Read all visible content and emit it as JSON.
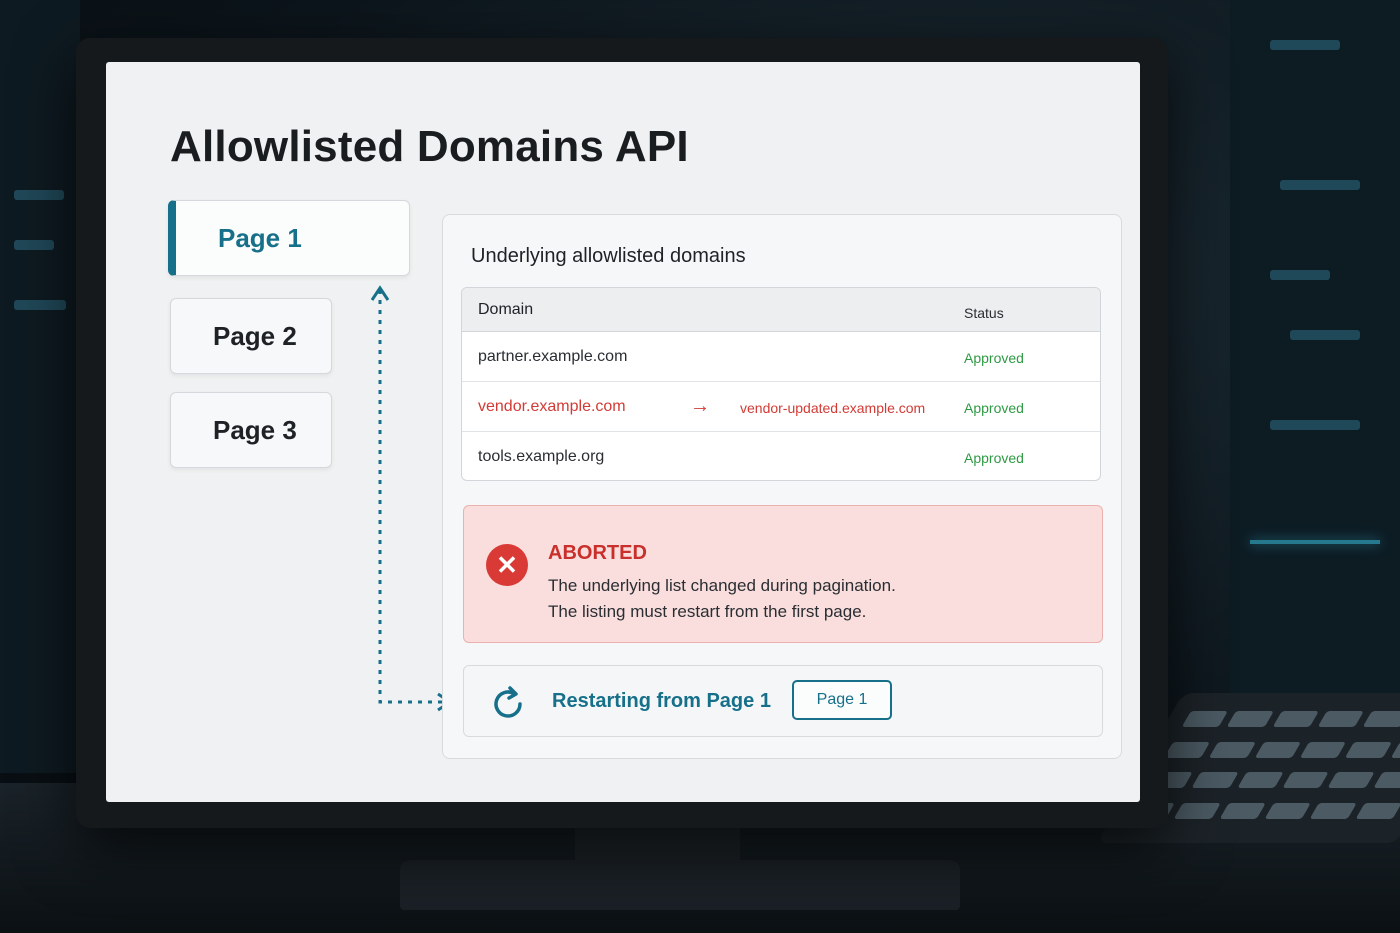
{
  "app": {
    "title": "Allowlisted Domains API"
  },
  "pages": [
    {
      "label": "Page 1",
      "active": true
    },
    {
      "label": "Page 2",
      "active": false
    },
    {
      "label": "Page 3",
      "active": false
    }
  ],
  "panel": {
    "title": "Underlying allowlisted domains",
    "table": {
      "headers": {
        "domain": "Domain",
        "status": "Status"
      },
      "rows": [
        {
          "domain": "partner.example.com",
          "status": "Approved",
          "changed": false
        },
        {
          "domain": "vendor.example.com",
          "new_domain": "vendor-updated.example.com",
          "arrow": "→",
          "status": "Approved",
          "changed": true
        },
        {
          "domain": "tools.example.org",
          "status": "Approved",
          "changed": false
        }
      ]
    },
    "alert": {
      "icon": "close-icon",
      "title": "ABORTED",
      "line1": "The underlying list changed during pagination.",
      "line2": "The listing must restart from the first page."
    },
    "restart": {
      "icon": "refresh-icon",
      "text": "Restarting from Page 1",
      "button_label": "Page 1"
    }
  },
  "colors": {
    "accent": "#17708a",
    "error": "#d23b35",
    "success": "#2f9a44",
    "alert_bg": "#f9dedd"
  }
}
